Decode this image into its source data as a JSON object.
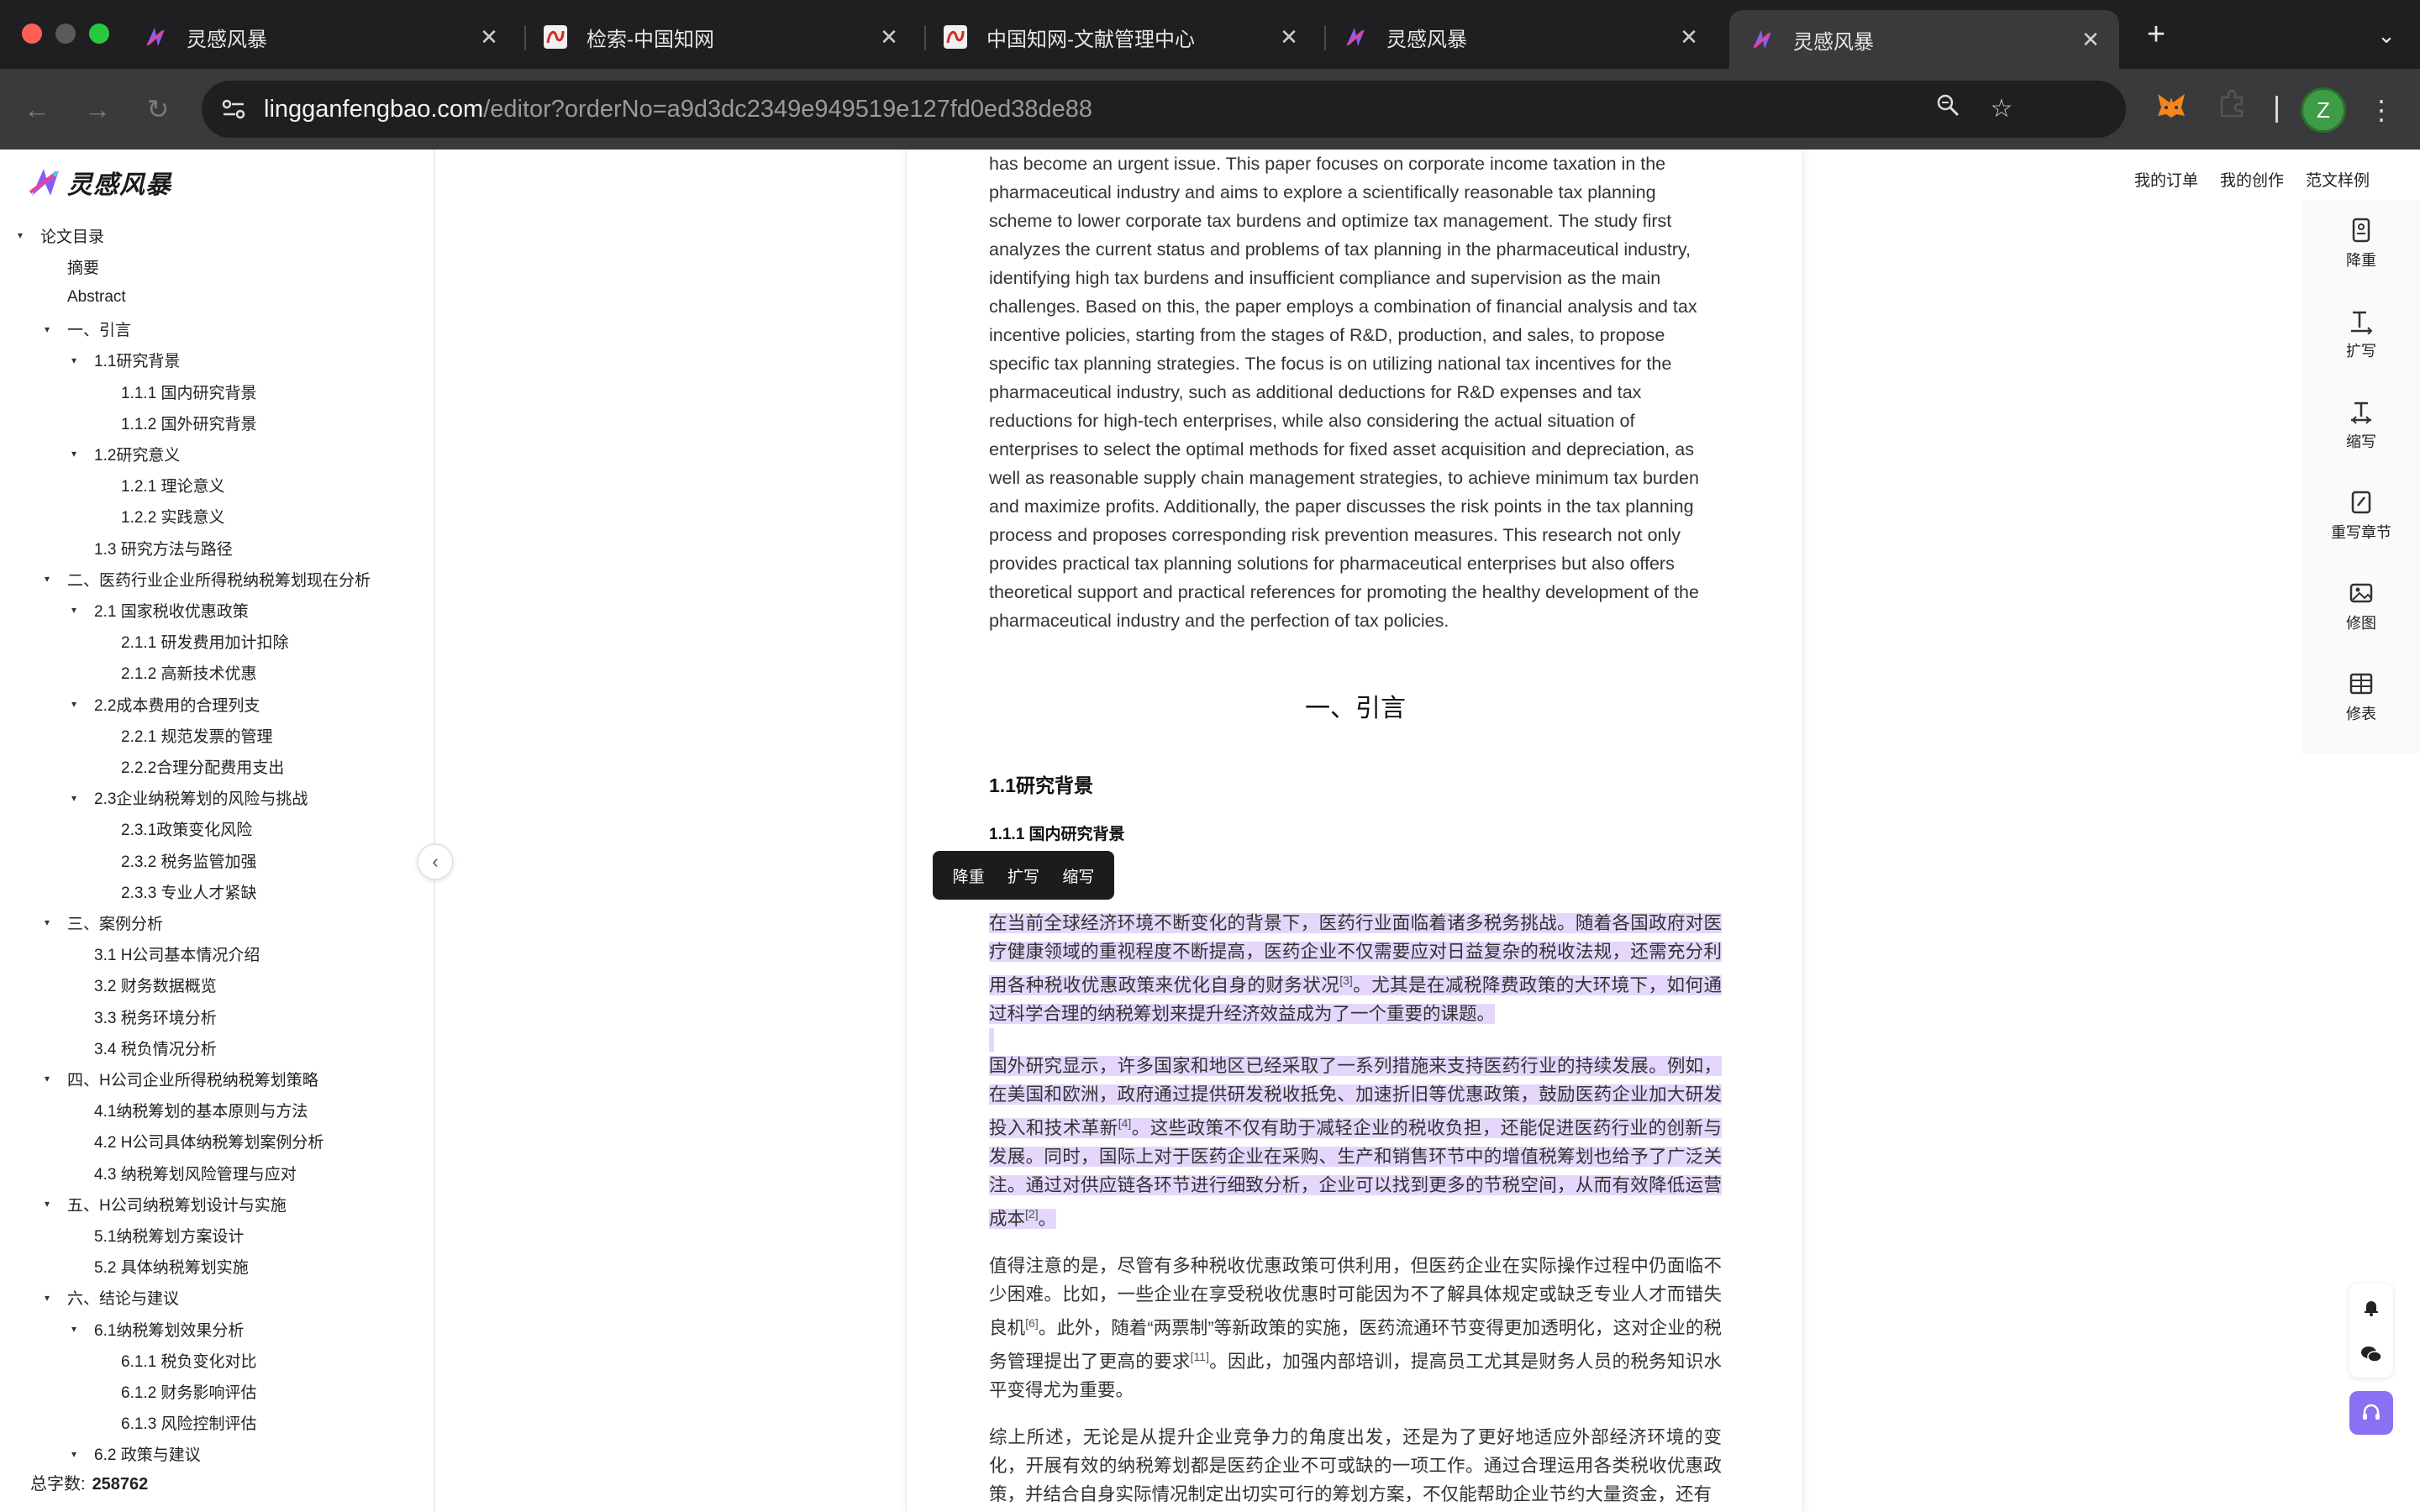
{
  "browser": {
    "tabs": [
      {
        "label": "灵感风暴",
        "icon": "lingganfengbao-icon",
        "active": false
      },
      {
        "label": "检索-中国知网",
        "icon": "cnki-icon",
        "active": false
      },
      {
        "label": "中国知网-文献管理中心",
        "icon": "cnki-icon",
        "active": false
      },
      {
        "label": "灵感风暴",
        "icon": "lingganfengbao-icon",
        "active": false
      },
      {
        "label": "灵感风暴",
        "icon": "lingganfengbao-icon",
        "active": true
      }
    ],
    "tab_close": "✕",
    "new_tab": "+",
    "url_host": "lingganfengbao.com",
    "url_path": "/editor?orderNo=a9d3dc2349e949519e127fd0ed38de88",
    "profile_initial": "Z",
    "colors": {
      "accent": "#8a70f3",
      "selection": "#e4d7fb",
      "profile": "#3f9b45"
    }
  },
  "app": {
    "logo_text": "灵感风暴",
    "top_nav": [
      "我的订单",
      "我的创作",
      "范文样例"
    ],
    "word_count_label": "总字数:",
    "word_count": "258762",
    "toc": [
      {
        "label": "论文目录",
        "level": 0,
        "caret": true
      },
      {
        "label": "摘要",
        "level": 1,
        "caret": false
      },
      {
        "label": "Abstract",
        "level": 1,
        "caret": false
      },
      {
        "label": "一、引言",
        "level": 1,
        "caret": true
      },
      {
        "label": "1.1研究背景",
        "level": 2,
        "caret": true
      },
      {
        "label": "1.1.1 国内研究背景",
        "level": 3,
        "caret": false
      },
      {
        "label": "1.1.2 国外研究背景",
        "level": 3,
        "caret": false
      },
      {
        "label": "1.2研究意义",
        "level": 2,
        "caret": true
      },
      {
        "label": "1.2.1 理论意义",
        "level": 3,
        "caret": false
      },
      {
        "label": "1.2.2 实践意义",
        "level": 3,
        "caret": false
      },
      {
        "label": "1.3 研究方法与路径",
        "level": 2,
        "caret": false
      },
      {
        "label": "二、医药行业企业所得税纳税筹划现在分析",
        "level": 1,
        "caret": true
      },
      {
        "label": "2.1 国家税收优惠政策",
        "level": 2,
        "caret": true
      },
      {
        "label": "2.1.1 研发费用加计扣除",
        "level": 3,
        "caret": false
      },
      {
        "label": "2.1.2 高新技术优惠",
        "level": 3,
        "caret": false
      },
      {
        "label": "2.2成本费用的合理列支",
        "level": 2,
        "caret": true
      },
      {
        "label": "2.2.1 规范发票的管理",
        "level": 3,
        "caret": false
      },
      {
        "label": "2.2.2合理分配费用支出",
        "level": 3,
        "caret": false
      },
      {
        "label": "2.3企业纳税筹划的风险与挑战",
        "level": 2,
        "caret": true
      },
      {
        "label": "2.3.1政策变化风险",
        "level": 3,
        "caret": false
      },
      {
        "label": "2.3.2 税务监管加强",
        "level": 3,
        "caret": false
      },
      {
        "label": "2.3.3 专业人才紧缺",
        "level": 3,
        "caret": false
      },
      {
        "label": "三、案例分析",
        "level": 1,
        "caret": true
      },
      {
        "label": "3.1 H公司基本情况介绍",
        "level": 2,
        "caret": false
      },
      {
        "label": "3.2 财务数据概览",
        "level": 2,
        "caret": false
      },
      {
        "label": "3.3 税务环境分析",
        "level": 2,
        "caret": false
      },
      {
        "label": "3.4 税负情况分析",
        "level": 2,
        "caret": false
      },
      {
        "label": "四、H公司企业所得税纳税筹划策略",
        "level": 1,
        "caret": true
      },
      {
        "label": "4.1纳税筹划的基本原则与方法",
        "level": 2,
        "caret": false
      },
      {
        "label": "4.2 H公司具体纳税筹划案例分析",
        "level": 2,
        "caret": false
      },
      {
        "label": "4.3 纳税筹划风险管理与应对",
        "level": 2,
        "caret": false
      },
      {
        "label": "五、H公司纳税筹划设计与实施",
        "level": 1,
        "caret": true
      },
      {
        "label": "5.1纳税筹划方案设计",
        "level": 2,
        "caret": false
      },
      {
        "label": "5.2 具体纳税筹划实施",
        "level": 2,
        "caret": false
      },
      {
        "label": "六、结论与建议",
        "level": 1,
        "caret": true
      },
      {
        "label": "6.1纳税筹划效果分析",
        "level": 2,
        "caret": true
      },
      {
        "label": "6.1.1 税负变化对比",
        "level": 3,
        "caret": false
      },
      {
        "label": "6.1.2 财务影响评估",
        "level": 3,
        "caret": false
      },
      {
        "label": "6.1.3 风险控制评估",
        "level": 3,
        "caret": false
      },
      {
        "label": "6.2 政策与建议",
        "level": 2,
        "caret": true
      }
    ],
    "float_toolbar": [
      "降重",
      "扩写",
      "缩写"
    ],
    "right_rail": [
      {
        "label": "降重",
        "icon": "document-icon"
      },
      {
        "label": "扩写",
        "icon": "expand-text-icon"
      },
      {
        "label": "缩写",
        "icon": "shrink-text-icon"
      },
      {
        "label": "重写章节",
        "icon": "rewrite-icon"
      },
      {
        "label": "修图",
        "icon": "image-icon"
      },
      {
        "label": "修表",
        "icon": "table-icon"
      }
    ]
  },
  "document": {
    "abstract_en_lines": [
      "has become an urgent issue. This paper focuses on corporate income taxation in the",
      "pharmaceutical industry and aims to explore a scientifically reasonable tax planning",
      "scheme to lower corporate tax burdens and optimize tax management. The study first",
      "analyzes the current status and problems of tax planning in the pharmaceutical industry,",
      "identifying high tax burdens and insufficient compliance and supervision as the main",
      "challenges. Based on this, the paper employs a combination of financial analysis and tax",
      "incentive policies, starting from the stages of R&D, production, and sales, to propose",
      "specific tax planning strategies. The focus is on utilizing national tax incentives for the",
      "pharmaceutical industry, such as additional deductions for R&D expenses and tax",
      "reductions for high-tech enterprises, while also considering the actual situation of",
      "enterprises to select the optimal methods for fixed asset acquisition and depreciation, as",
      "well as reasonable supply chain management strategies, to achieve minimum tax burden",
      "and maximize profits. Additionally, the paper discusses the risk points in the tax planning",
      "process and proposes corresponding risk prevention measures. This research not only",
      "provides practical tax planning solutions for pharmaceutical enterprises but also offers",
      "theoretical support and practical references for promoting the healthy development of the",
      "pharmaceutical industry and the perfection of tax policies."
    ],
    "h1": "一、引言",
    "h2": "1.1研究背景",
    "h3": "1.1.1 国内研究背景",
    "h3_hidden_tail": "景",
    "p1_a": "在当前全球经济环境不断变化的背景下，医药行业面临着诸多税务挑战。随着各国政府对医疗健康领域的重视程度不断提高，医药企业不仅需要应对日益复杂的税收法规，还需充分利用各种税收优惠政策来优化自身的财务状况",
    "p1_ref": "[3]",
    "p1_b": "。尤其是在减税降费政策的大环境下，如何通过科学合理的纳税筹划来提升经济效益成为了一个重要的课题。",
    "p2_a": "国外研究显示，许多国家和地区已经采取了一系列措施来支持医药行业的持续发展。例如，在美国和欧洲，政府通过提供研发税收抵免、加速折旧等优惠政策，鼓励医药企业加大研发投入和技术革新",
    "p2_ref1": "[4]",
    "p2_b": "。这些政策不仅有助于减轻企业的税收负担，还能促进医药行业的创新与发展。同时，国际上对于医药企业在采购、生产和销售环节中的增值税筹划也给予了广泛关注。通过对供应链各环节进行细致分析，企业可以找到更多的节税空间，从而有效降低运营成本",
    "p2_ref2": "[2]",
    "p2_c": "。",
    "p3_a": "值得注意的是，尽管有多种税收优惠政策可供利用，但医药企业在实际操作过程中仍面临不少困难。比如，一些企业在享受税收优惠时可能因为不了解具体规定或缺乏专业人才而错失良机",
    "p3_ref1": "[6]",
    "p3_b": "。此外，随着“两票制”等新政策的实施，医药流通环节变得更加透明化，这对企业的税务管理提出了更高的要求",
    "p3_ref2": "[11]",
    "p3_c": "。因此，加强内部培训，提高员工尤其是财务人员的税务知识水平变得尤为重要。",
    "p4": "综上所述，无论是从提升企业竞争力的角度出发，还是为了更好地适应外部经济环境的变化，开展有效的纳税筹划都是医药企业不可或缺的一项工作。通过合理运用各类税收优惠政策，并结合自身实际情况制定出切实可行的筹划方案，不仅能帮助企业节约大量资金，还有"
  }
}
